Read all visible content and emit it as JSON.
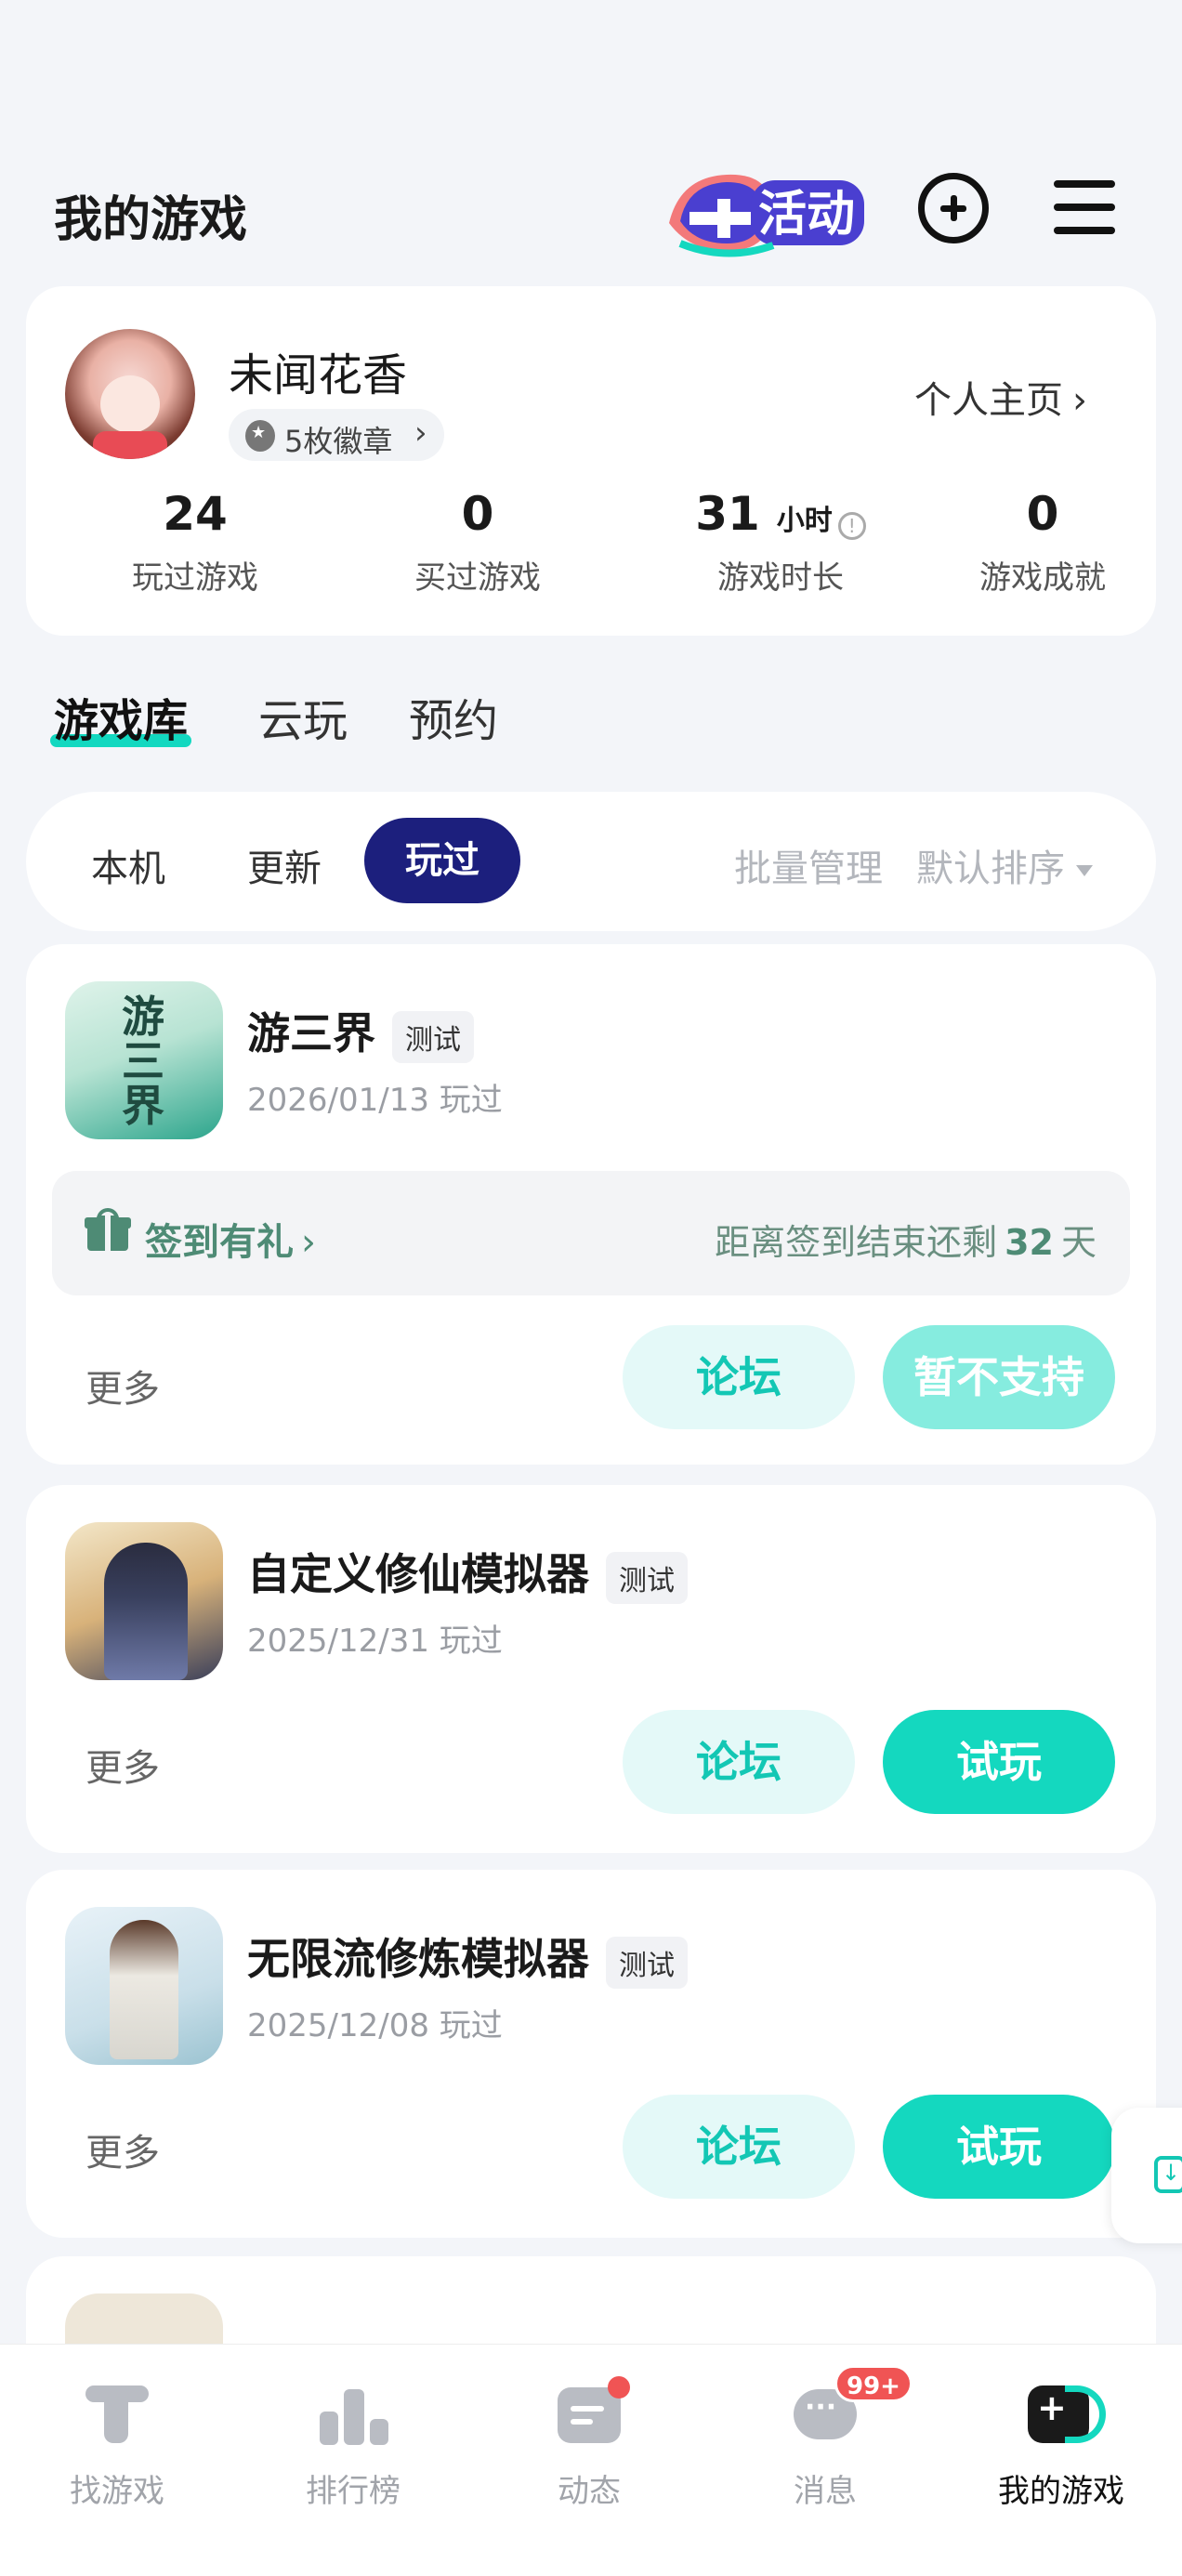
{
  "header": {
    "title": "我的游戏",
    "event_logo_text": "活动"
  },
  "profile": {
    "username": "未闻花香",
    "badges_label": "5枚徽章",
    "homepage_label": "个人主页",
    "stats": [
      {
        "value": "24",
        "label": "玩过游戏"
      },
      {
        "value": "0",
        "label": "买过游戏"
      },
      {
        "value": "31",
        "unit": "小时",
        "label": "游戏时长"
      },
      {
        "value": "0",
        "label": "游戏成就"
      }
    ]
  },
  "library_tabs": [
    "游戏库",
    "云玩",
    "预约"
  ],
  "filters": {
    "left": [
      "本机",
      "更新",
      "玩过"
    ],
    "batch_manage": "批量管理",
    "sort": "默认排序"
  },
  "games": [
    {
      "icon_text": "游三界",
      "title": "游三界",
      "tag": "测试",
      "date": "2026/01/13 玩过",
      "signin_label": "签到有礼",
      "signin_prefix": "距离签到结束还剩",
      "signin_days": "32",
      "signin_suffix": "天",
      "more": "更多",
      "forum": "论坛",
      "action": "暂不支持"
    },
    {
      "title": "自定义修仙模拟器",
      "tag": "测试",
      "date": "2025/12/31 玩过",
      "more": "更多",
      "forum": "论坛",
      "action": "试玩"
    },
    {
      "title": "无限流修炼模拟器",
      "tag": "测试",
      "date": "2025/12/08 玩过",
      "more": "更多",
      "forum": "论坛",
      "action": "试玩"
    }
  ],
  "bottom_nav": [
    {
      "label": "找游戏",
      "icon": "find-game-icon"
    },
    {
      "label": "排行榜",
      "icon": "ranking-icon"
    },
    {
      "label": "动态",
      "icon": "feed-icon"
    },
    {
      "label": "消息",
      "icon": "message-icon",
      "badge": "99+"
    },
    {
      "label": "我的游戏",
      "icon": "my-games-icon"
    }
  ],
  "colors": {
    "accent": "#14d8bf",
    "active_filter": "#1c1f7d",
    "signin_green": "#4e8b75"
  }
}
